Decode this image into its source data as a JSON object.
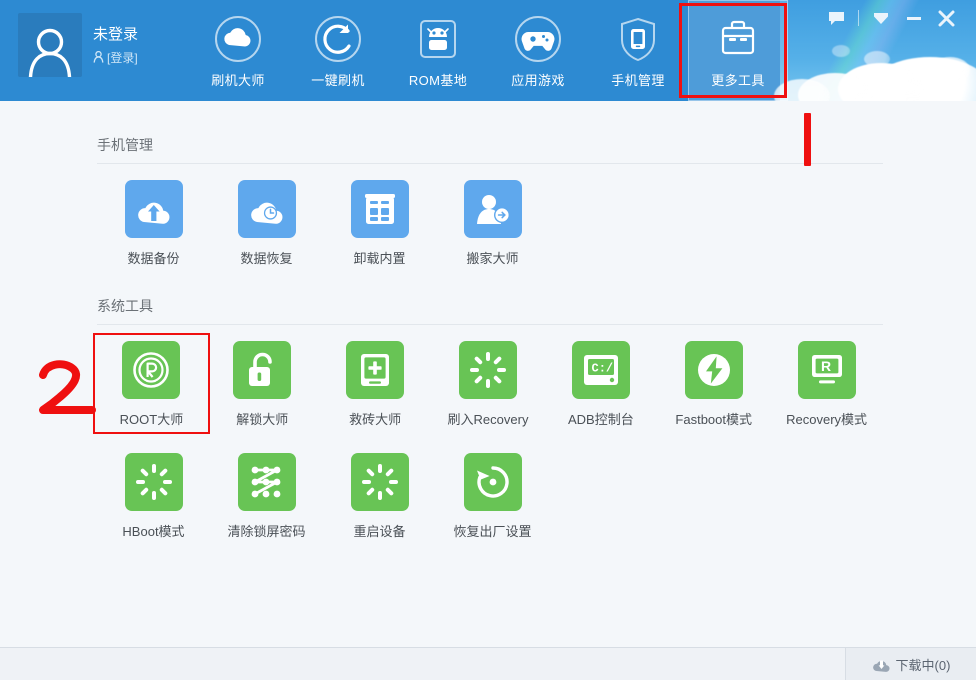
{
  "window": {
    "controls": [
      {
        "name": "feedback-icon",
        "glyph": "speech-bubble"
      },
      {
        "name": "menu-icon",
        "glyph": "chevron-down-filled"
      },
      {
        "name": "minimize-icon",
        "glyph": "minus"
      },
      {
        "name": "close-icon",
        "glyph": "cross"
      }
    ]
  },
  "header": {
    "accent_color": "#2d8ad2",
    "user": {
      "avatar_icon": "person-icon",
      "name": "未登录",
      "login_icon": "person-small-icon",
      "login_label": "[登录]"
    },
    "nav": [
      {
        "label": "刷机大师",
        "icon": "cloud-circle-icon",
        "active": false
      },
      {
        "label": "一键刷机",
        "icon": "refresh-circle-icon",
        "active": false
      },
      {
        "label": "ROM基地",
        "icon": "android-box-icon",
        "active": false
      },
      {
        "label": "应用游戏",
        "icon": "gamepad-circle-icon",
        "active": false
      },
      {
        "label": "手机管理",
        "icon": "shield-phone-icon",
        "active": false
      },
      {
        "label": "更多工具",
        "icon": "toolbox-icon",
        "active": true
      }
    ]
  },
  "main": {
    "sections": [
      {
        "title": "手机管理",
        "tile_color": "#5fa8ed",
        "tile_style": "blue",
        "rows": [
          [
            {
              "label": "数据备份",
              "icon": "cloud-upload-icon",
              "highlighted": false
            },
            {
              "label": "数据恢复",
              "icon": "cloud-clock-icon",
              "highlighted": false
            },
            {
              "label": "卸载内置",
              "icon": "uninstall-apps-icon",
              "highlighted": false
            },
            {
              "label": "搬家大师",
              "icon": "person-transfer-icon",
              "highlighted": false
            }
          ]
        ]
      },
      {
        "title": "系统工具",
        "tile_color": "#68c455",
        "tile_style": "green",
        "rows": [
          [
            {
              "label": "ROOT大师",
              "icon": "root-circle-icon",
              "highlighted": true
            },
            {
              "label": "解锁大师",
              "icon": "unlock-padlock-icon",
              "highlighted": false
            },
            {
              "label": "救砖大师",
              "icon": "phone-rescue-icon",
              "highlighted": false
            },
            {
              "label": "刷入Recovery",
              "icon": "spinner-icon",
              "highlighted": false
            },
            {
              "label": "ADB控制台",
              "icon": "console-icon",
              "highlighted": false
            },
            {
              "label": "Fastboot模式",
              "icon": "lightning-circle-icon",
              "highlighted": false
            },
            {
              "label": "Recovery模式",
              "icon": "recovery-screen-icon",
              "highlighted": false
            }
          ],
          [
            {
              "label": "HBoot模式",
              "icon": "spinner-icon",
              "highlighted": false
            },
            {
              "label": "清除锁屏密码",
              "icon": "pattern-lock-icon",
              "highlighted": false
            },
            {
              "label": "重启设备",
              "icon": "spinner-icon",
              "highlighted": false
            },
            {
              "label": "恢复出厂设置",
              "icon": "restore-circle-icon",
              "highlighted": false
            }
          ]
        ]
      }
    ]
  },
  "annotations": {
    "color": "#ef1010",
    "marker_one": "1",
    "marker_two": "2",
    "highlight_tab": "更多工具",
    "highlight_tile": "ROOT大师"
  },
  "footer": {
    "download_icon": "cloud-download-icon",
    "download_label": "下载中(0)"
  }
}
